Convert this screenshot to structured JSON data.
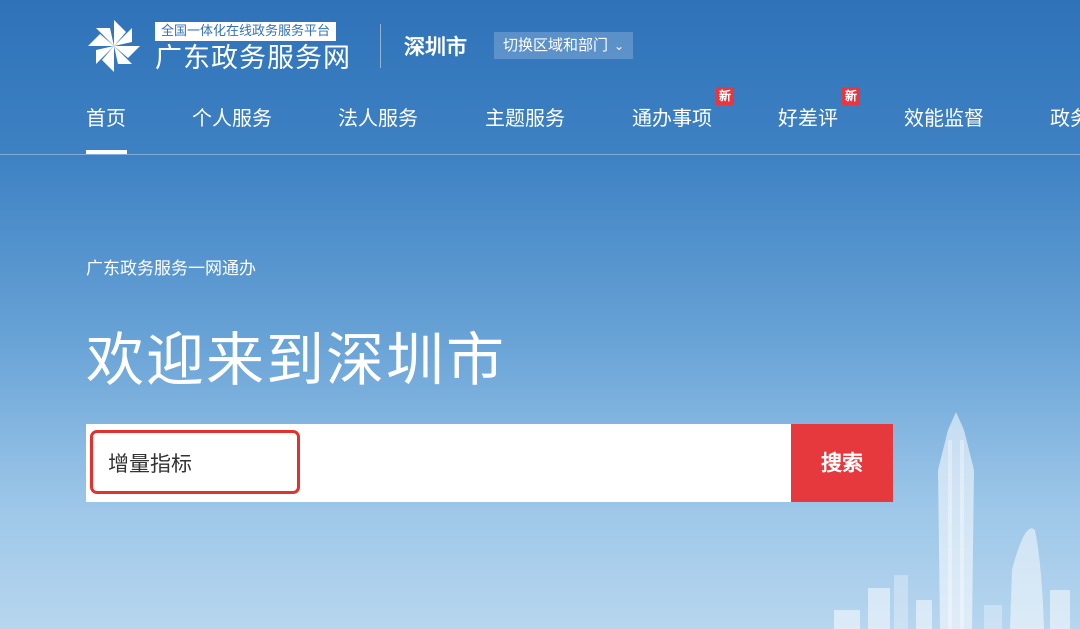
{
  "header": {
    "logo_tag": "全国一体化在线政务服务平台",
    "logo_title": "广东政务服务网",
    "city": "深圳市",
    "switch_label": "切换区域和部门"
  },
  "nav": {
    "items": [
      {
        "label": "首页",
        "badge": ""
      },
      {
        "label": "个人服务",
        "badge": ""
      },
      {
        "label": "法人服务",
        "badge": ""
      },
      {
        "label": "主题服务",
        "badge": ""
      },
      {
        "label": "通办事项",
        "badge": "新"
      },
      {
        "label": "好差评",
        "badge": "新"
      },
      {
        "label": "效能监督",
        "badge": ""
      },
      {
        "label": "政务",
        "badge": ""
      }
    ],
    "active_index": 0
  },
  "hero": {
    "subtitle": "广东政务服务一网通办",
    "welcome": "欢迎来到深圳市"
  },
  "search": {
    "value": "增量指标",
    "button_label": "搜索"
  },
  "colors": {
    "accent_red": "#e5393d",
    "background_top": "#2f72b8",
    "background_bottom": "#b7d6ef"
  }
}
